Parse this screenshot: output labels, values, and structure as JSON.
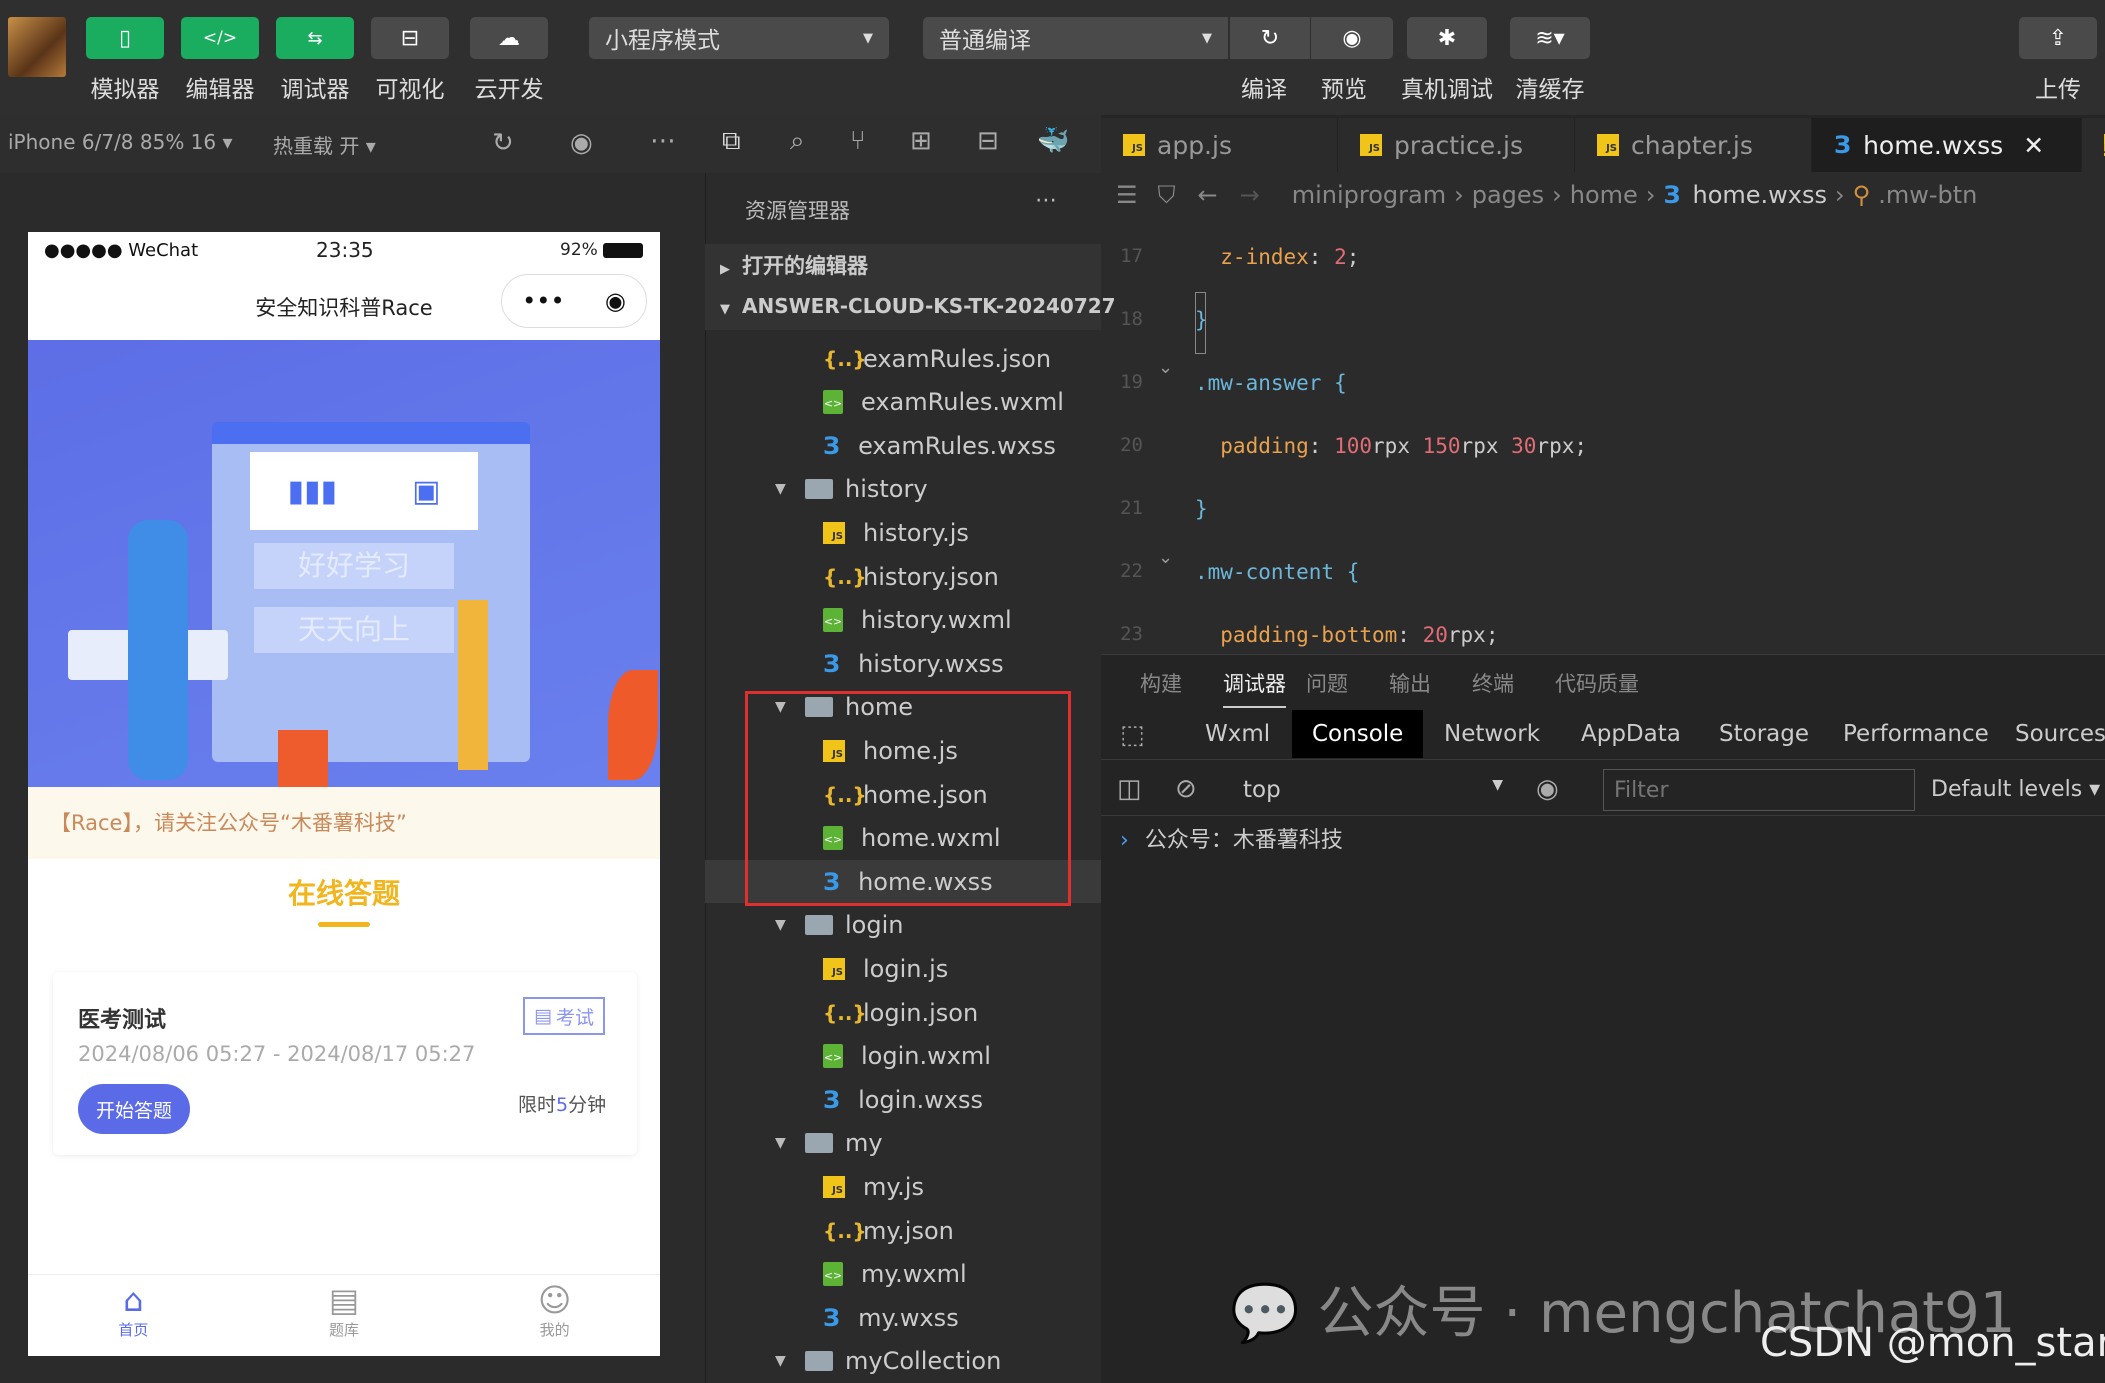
{
  "toolbar": {
    "buttons": [
      {
        "label": "模拟器",
        "icon": "phone-icon"
      },
      {
        "label": "编辑器",
        "icon": "code-icon"
      },
      {
        "label": "调试器",
        "icon": "debugger-icon"
      },
      {
        "label": "可视化",
        "icon": "layout-icon"
      },
      {
        "label": "云开发",
        "icon": "cloud-icon"
      }
    ],
    "mode_select": "小程序模式",
    "compile_select": "普通编译",
    "actions": [
      {
        "label": "编译",
        "icon": "refresh-icon"
      },
      {
        "label": "预览",
        "icon": "eye-icon"
      },
      {
        "label": "真机调试",
        "icon": "bug-icon"
      },
      {
        "label": "清缓存",
        "icon": "layers-icon"
      }
    ],
    "upload": "上传",
    "accent": "#1aad5f"
  },
  "simulator": {
    "device": "iPhone 6/7/8 85% 16 ▾",
    "hot_reload": "热重载 开 ▾",
    "phone": {
      "status": {
        "carrier": "●●●●● WeChat",
        "time": "23:35",
        "battery": "92%"
      },
      "title": "安全知识科普Race",
      "banner_texts": [
        "好好学习",
        "天天向上"
      ],
      "notice": "【Race】，请关注公众号“木番薯科技”",
      "section_title": "在线答题",
      "card": {
        "title": "医考测试",
        "tag": "考试",
        "dates": "2024/08/06 05:27 - 2024/08/17 05:27",
        "button": "开始答题",
        "limit_prefix": "限时",
        "limit_value": "5",
        "limit_suffix": "分钟"
      },
      "tabbar": [
        {
          "label": "首页",
          "icon": "home-icon",
          "active": true
        },
        {
          "label": "题库",
          "icon": "document-icon"
        },
        {
          "label": "我的",
          "icon": "user-icon"
        }
      ],
      "primary": "#5b6be8"
    }
  },
  "explorer": {
    "title": "资源管理器",
    "open_editors": "打开的编辑器",
    "project": "ANSWER-CLOUD-KS-TK-20240727",
    "items": [
      {
        "name": "examRules.json",
        "type": "json"
      },
      {
        "name": "examRules.wxml",
        "type": "wxml"
      },
      {
        "name": "examRules.wxss",
        "type": "wxss"
      },
      {
        "name": "history",
        "type": "folder"
      },
      {
        "name": "history.js",
        "type": "js"
      },
      {
        "name": "history.json",
        "type": "json"
      },
      {
        "name": "history.wxml",
        "type": "wxml"
      },
      {
        "name": "history.wxss",
        "type": "wxss"
      },
      {
        "name": "home",
        "type": "folder"
      },
      {
        "name": "home.js",
        "type": "js"
      },
      {
        "name": "home.json",
        "type": "json"
      },
      {
        "name": "home.wxml",
        "type": "wxml"
      },
      {
        "name": "home.wxss",
        "type": "wxss",
        "selected": true
      },
      {
        "name": "login",
        "type": "folder"
      },
      {
        "name": "login.js",
        "type": "js"
      },
      {
        "name": "login.json",
        "type": "json"
      },
      {
        "name": "login.wxml",
        "type": "wxml"
      },
      {
        "name": "login.wxss",
        "type": "wxss"
      },
      {
        "name": "my",
        "type": "folder"
      },
      {
        "name": "my.js",
        "type": "js"
      },
      {
        "name": "my.json",
        "type": "json"
      },
      {
        "name": "my.wxml",
        "type": "wxml"
      },
      {
        "name": "my.wxss",
        "type": "wxss"
      },
      {
        "name": "myCollection",
        "type": "folder"
      }
    ]
  },
  "editor": {
    "tabs": [
      {
        "label": "app.js",
        "type": "js"
      },
      {
        "label": "practice.js",
        "type": "js"
      },
      {
        "label": "chapter.js",
        "type": "js"
      },
      {
        "label": "home.wxss",
        "type": "wxss",
        "active": true
      }
    ],
    "breadcrumb": [
      "miniprogram",
      "pages",
      "home",
      "home.wxss",
      ".mw-btn"
    ],
    "lines": [
      {
        "n": "17",
        "code": [
          [
            "prop",
            "  z-index"
          ],
          [
            "pl",
            ": "
          ],
          [
            "num",
            "2"
          ],
          [
            "pl",
            ";"
          ]
        ]
      },
      {
        "n": "18",
        "code": [
          [
            "sel",
            "}"
          ]
        ]
      },
      {
        "n": "19",
        "code": [
          [
            "sel",
            ".mw-answer {"
          ]
        ]
      },
      {
        "n": "20",
        "code": [
          [
            "prop",
            "  padding"
          ],
          [
            "pl",
            ": "
          ],
          [
            "num",
            "100"
          ],
          [
            "pl",
            "rpx "
          ],
          [
            "num",
            "150"
          ],
          [
            "pl",
            "rpx "
          ],
          [
            "num",
            "30"
          ],
          [
            "pl",
            "rpx;"
          ]
        ]
      },
      {
        "n": "21",
        "code": [
          [
            "sel",
            "}"
          ]
        ]
      },
      {
        "n": "22",
        "code": [
          [
            "sel",
            ".mw-content {"
          ]
        ]
      },
      {
        "n": "23",
        "code": [
          [
            "prop",
            "  padding-bottom"
          ],
          [
            "pl",
            ": "
          ],
          [
            "num",
            "20"
          ],
          [
            "pl",
            "rpx;"
          ]
        ]
      }
    ]
  },
  "panel": {
    "tabs": [
      "构建",
      "调试器",
      "问题",
      "输出",
      "终端",
      "代码质量"
    ],
    "active_tab": "调试器",
    "devtools_tabs": [
      "Wxml",
      "Console",
      "Network",
      "AppData",
      "Storage",
      "Performance",
      "Sources"
    ],
    "active_devtools": "Console",
    "context": "top",
    "filter_placeholder": "Filter",
    "levels": "Default levels ▾",
    "log": "公众号：木番薯科技"
  },
  "watermark": {
    "text": "公众号 · mengchatchat91",
    "credit": "CSDN @mon_star°"
  }
}
